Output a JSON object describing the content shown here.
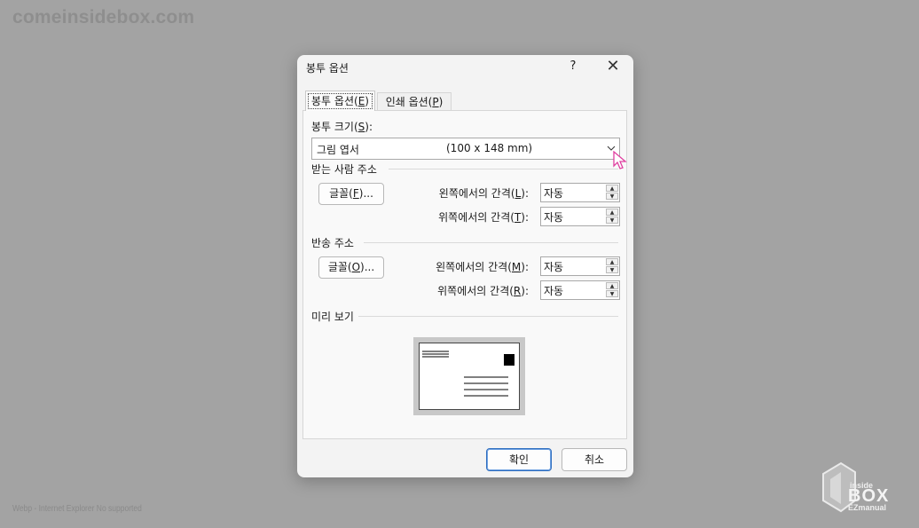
{
  "watermark_top": "comeinsidebox.com",
  "watermark_bottom": "Webp - Internet Explorer No supported",
  "logo": {
    "line1": "inside",
    "line2": "BOX",
    "line3": "EZmanual"
  },
  "dialog": {
    "title": "봉투 옵션",
    "help": "?",
    "close": "✕",
    "tabs": [
      {
        "label": "봉투 옵션(",
        "key": "E",
        "suffix": ")"
      },
      {
        "label": "인쇄 옵션(",
        "key": "P",
        "suffix": ")"
      }
    ],
    "envelope_size": {
      "label": "봉투 크기(",
      "key": "S",
      "suffix": "):",
      "selected_name": "그림 엽서",
      "selected_size": "(100 x 148 mm)"
    },
    "delivery": {
      "group_label": "받는 사람 주소",
      "font_button": {
        "label": "글꼴(",
        "key": "F",
        "suffix": ")..."
      },
      "left_label": {
        "label": "왼쪽에서의 간격(",
        "key": "L",
        "suffix": "):"
      },
      "left_value": "자동",
      "top_label": {
        "label": "위쪽에서의 간격(",
        "key": "T",
        "suffix": "):"
      },
      "top_value": "자동"
    },
    "return": {
      "group_label": "반송 주소",
      "font_button": {
        "label": "글꼴(",
        "key": "O",
        "suffix": ")..."
      },
      "left_label": {
        "label": "왼쪽에서의 간격(",
        "key": "M",
        "suffix": "):"
      },
      "left_value": "자동",
      "top_label": {
        "label": "위쪽에서의 간격(",
        "key": "R",
        "suffix": "):"
      },
      "top_value": "자동"
    },
    "preview_label": "미리 보기",
    "ok": "확인",
    "cancel": "취소"
  },
  "colors": {
    "background": "#a3a3a3",
    "dialog": "#f3f3f3",
    "panel": "#f9f9f9",
    "focus_border": "#2f6ebf",
    "cursor": "#e040a0"
  }
}
